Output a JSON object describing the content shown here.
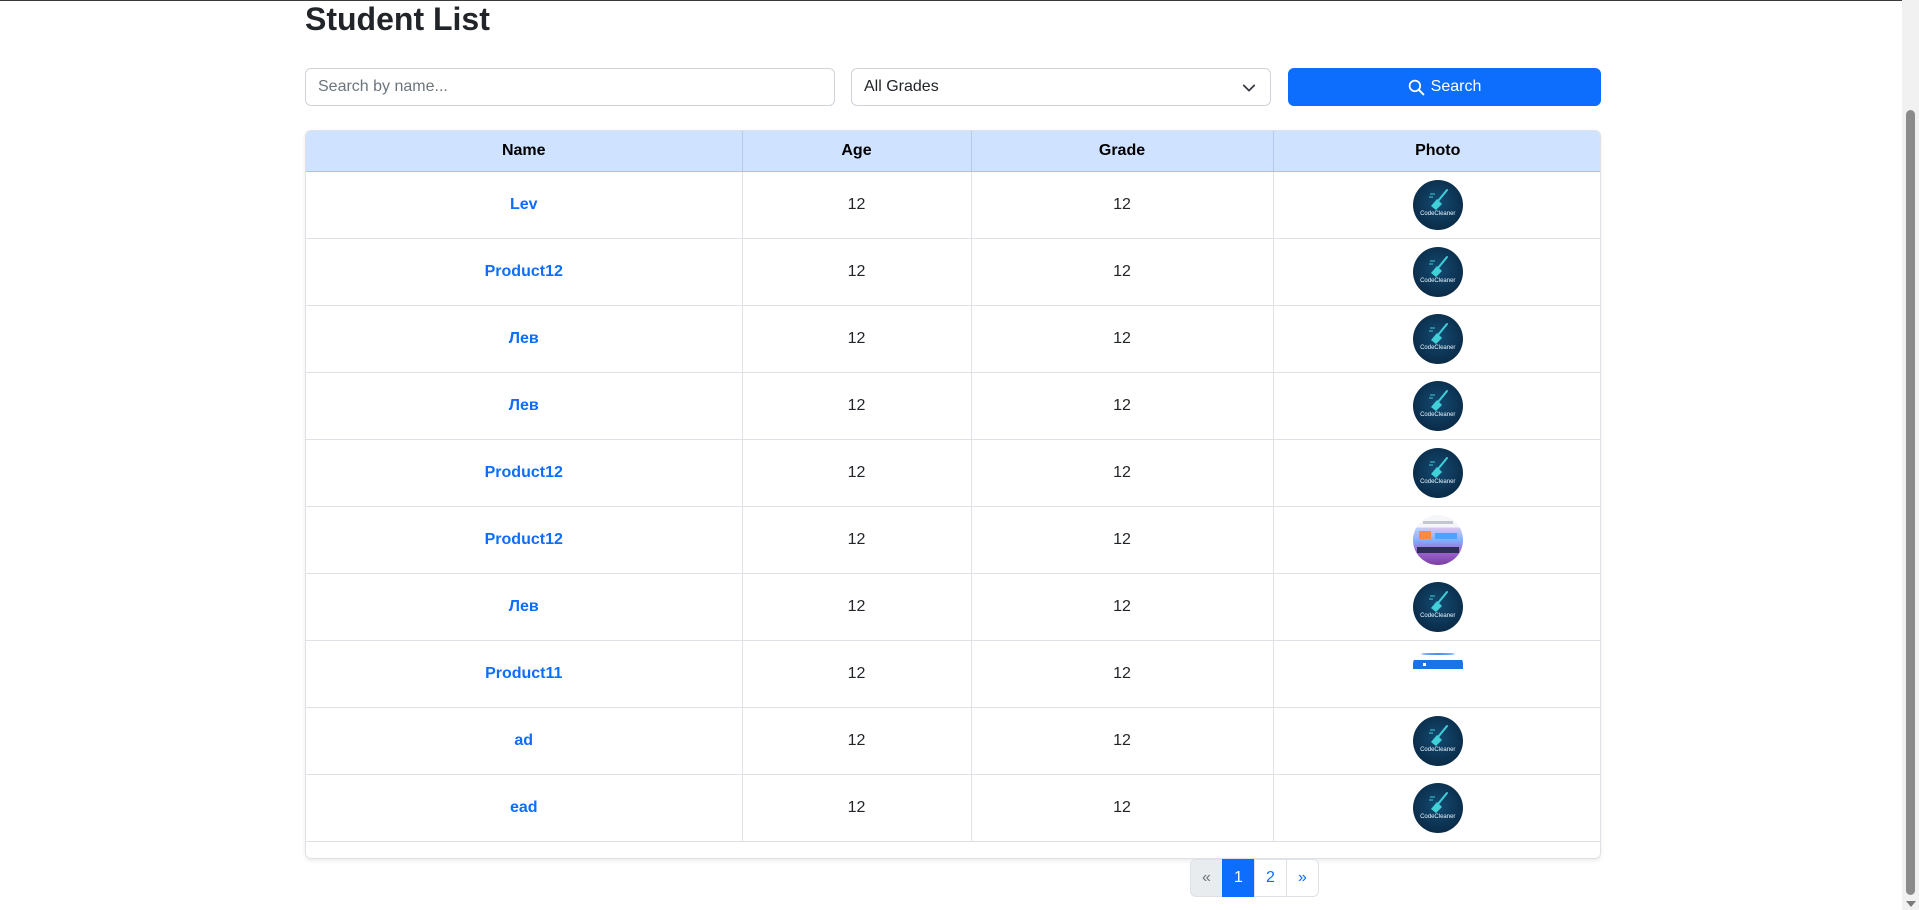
{
  "page": {
    "title": "Student List"
  },
  "filters": {
    "search_placeholder": "Search by name...",
    "grade_selected": "All Grades",
    "search_button": "Search"
  },
  "table": {
    "columns": [
      "Name",
      "Age",
      "Grade",
      "Photo"
    ],
    "rows": [
      {
        "name": "Lev",
        "age": "12",
        "grade": "12",
        "photo": "codecleaner-logo"
      },
      {
        "name": "Product12",
        "age": "12",
        "grade": "12",
        "photo": "codecleaner-logo"
      },
      {
        "name": "Лев",
        "age": "12",
        "grade": "12",
        "photo": "codecleaner-logo"
      },
      {
        "name": "Лев",
        "age": "12",
        "grade": "12",
        "photo": "codecleaner-logo"
      },
      {
        "name": "Product12",
        "age": "12",
        "grade": "12",
        "photo": "codecleaner-logo"
      },
      {
        "name": "Product12",
        "age": "12",
        "grade": "12",
        "photo": "screenshot-collage"
      },
      {
        "name": "Лев",
        "age": "12",
        "grade": "12",
        "photo": "codecleaner-logo"
      },
      {
        "name": "Product11",
        "age": "12",
        "grade": "12",
        "photo": "blue-banner"
      },
      {
        "name": "ad",
        "age": "12",
        "grade": "12",
        "photo": "codecleaner-logo"
      },
      {
        "name": "ead",
        "age": "12",
        "grade": "12",
        "photo": "codecleaner-logo"
      }
    ],
    "logo_text": "CodeCleaner"
  },
  "pagination": {
    "prev": "«",
    "pages": [
      "1",
      "2"
    ],
    "active_page": "1",
    "next": "»"
  },
  "colors": {
    "primary": "#0d6efd",
    "header_bg": "#cfe2ff"
  }
}
